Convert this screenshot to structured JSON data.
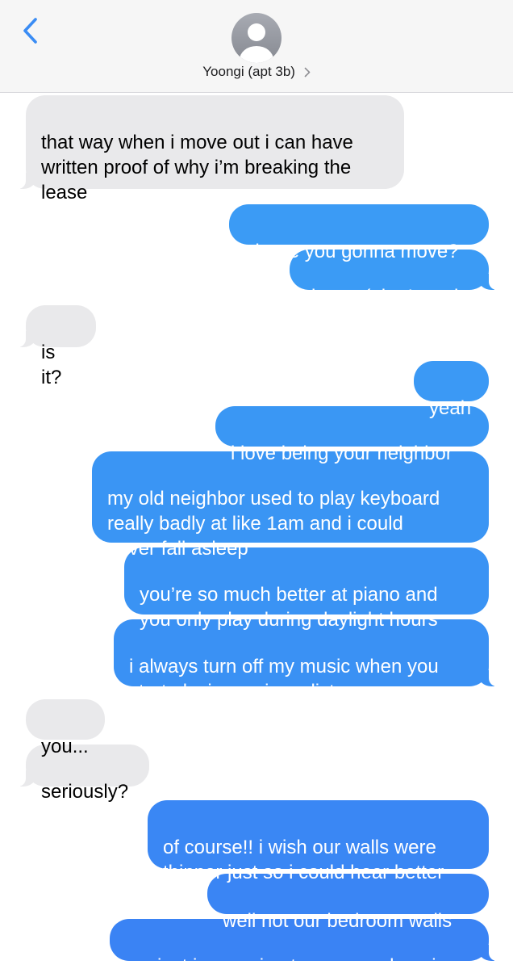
{
  "header": {
    "back_icon": "chevron-left-icon",
    "avatar_icon": "person-silhouette-icon",
    "contact_name": "Yoongi (apt 3b)",
    "contact_chevron_icon": "chevron-right-icon"
  },
  "colors": {
    "header_bg": "#f6f6f6",
    "accent": "#3a8cf4",
    "incoming_bubble": "#e9e9eb",
    "outgoing_bubble": "#3a8cf4"
  },
  "messages": [
    {
      "direction": "incoming",
      "text": "that way when i move out i can have\nwritten proof of why i’m breaking the\nlease"
    },
    {
      "direction": "outgoing",
      "text": "oh are you gonna move?"
    },
    {
      "direction": "outgoing",
      "text": "damn :( that’s sad"
    },
    {
      "direction": "incoming",
      "text": "is it?"
    },
    {
      "direction": "outgoing",
      "text": "yeah"
    },
    {
      "direction": "outgoing",
      "text": "i love being your neighbor"
    },
    {
      "direction": "outgoing",
      "text": "my old neighbor used to play keyboard\nreally badly at like 1am and i could\nnever fall asleep"
    },
    {
      "direction": "outgoing",
      "text": "you’re so much better at piano and\nyou only play during daylight hours"
    },
    {
      "direction": "outgoing",
      "text": "i always turn off my music when you\nstart playing so i can listen"
    },
    {
      "direction": "incoming",
      "text": "you..."
    },
    {
      "direction": "incoming",
      "text": "seriously?"
    },
    {
      "direction": "outgoing",
      "text": "of course!! i wish our walls were\nthinner just so i could hear better"
    },
    {
      "direction": "outgoing",
      "text": "well not our bedroom walls"
    },
    {
      "direction": "outgoing",
      "text": "um just in case i get possessed again"
    }
  ]
}
